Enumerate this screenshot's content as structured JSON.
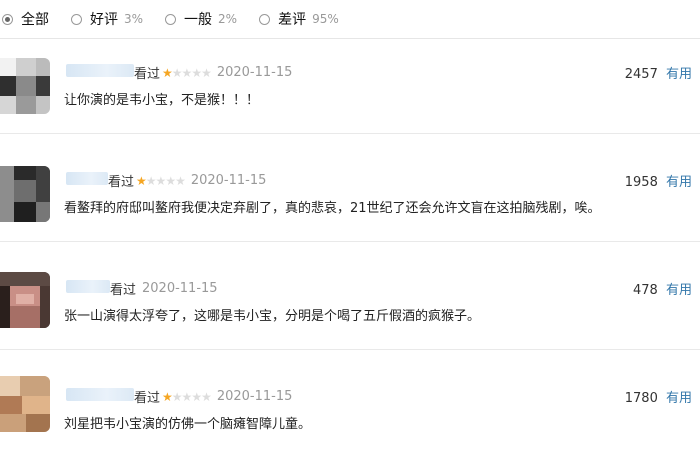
{
  "filter": {
    "options": [
      {
        "label": "全部",
        "pct": "",
        "checked": true
      },
      {
        "label": "好评",
        "pct": "3%",
        "checked": false
      },
      {
        "label": "一般",
        "pct": "2%",
        "checked": false
      },
      {
        "label": "差评",
        "pct": "95%",
        "checked": false
      }
    ]
  },
  "reviews": [
    {
      "status": "看过",
      "rating": 1,
      "rating_max": 5,
      "date": "2020-11-15",
      "useful_count": "2457",
      "useful_label": "有用",
      "content": "让你演的是韦小宝，不是猴！！！"
    },
    {
      "status": "看过",
      "rating": 1,
      "rating_max": 5,
      "date": "2020-11-15",
      "useful_count": "1958",
      "useful_label": "有用",
      "content": "看鳌拜的府邸叫鳌府我便决定弃剧了，真的悲哀，21世纪了还会允许文盲在这拍脑残剧，唉。"
    },
    {
      "status": "看过",
      "rating": 0,
      "rating_max": 5,
      "date": "2020-11-15",
      "useful_count": "478",
      "useful_label": "有用",
      "content": "张一山演得太浮夸了，这哪是韦小宝，分明是个喝了五斤假酒的疯猴子。"
    },
    {
      "status": "看过",
      "rating": 1,
      "rating_max": 5,
      "date": "2020-11-15",
      "useful_count": "1780",
      "useful_label": "有用",
      "content": "刘星把韦小宝演的仿佛一个脑瘫智障儿童。"
    }
  ]
}
